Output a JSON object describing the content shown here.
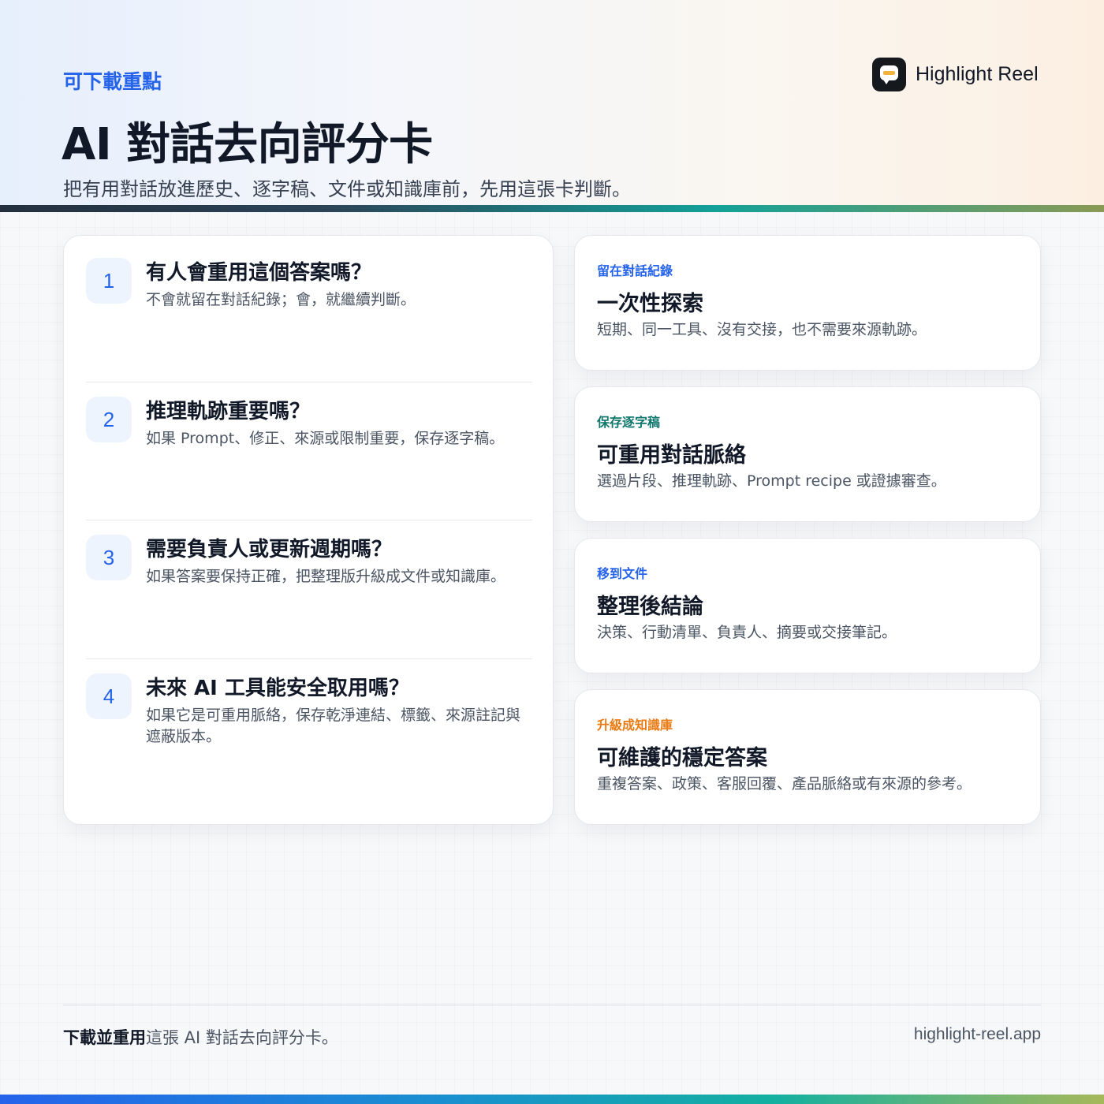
{
  "header": {
    "eyebrow": "可下載重點",
    "title": "AI 對話去向評分卡",
    "subtitle": "把有用對話放進歷史、逐字稿、文件或知識庫前，先用這張卡判斷。"
  },
  "brand": {
    "name": "Highlight Reel",
    "icon": "chat-bubble-icon"
  },
  "steps": [
    {
      "number": "1",
      "title": "有人會重用這個答案嗎？",
      "desc": "不會就留在對話紀錄；會，就繼續判斷。"
    },
    {
      "number": "2",
      "title": "推理軌跡重要嗎？",
      "desc": "如果 Prompt、修正、來源或限制重要，保存逐字稿。"
    },
    {
      "number": "3",
      "title": "需要負責人或更新週期嗎？",
      "desc": "如果答案要保持正確，把整理版升級成文件或知識庫。"
    },
    {
      "number": "4",
      "title": "未來 AI 工具能安全取用嗎？",
      "desc": "如果它是可重用脈絡，保存乾淨連結、標籤、來源註記與遮蔽版本。"
    }
  ],
  "destinations": [
    {
      "tag": "留在對話紀錄",
      "tag_color": "#2563eb",
      "title": "一次性探索",
      "desc": "短期、同一工具、沒有交接，也不需要來源軌跡。"
    },
    {
      "tag": "保存逐字稿",
      "tag_color": "#0f766e",
      "title": "可重用對話脈絡",
      "desc": "選過片段、推理軌跡、Prompt recipe 或證據審查。"
    },
    {
      "tag": "移到文件",
      "tag_color": "#2563eb",
      "title": "整理後結論",
      "desc": "決策、行動清單、負責人、摘要或交接筆記。"
    },
    {
      "tag": "升級成知識庫",
      "tag_color": "#ea7a12",
      "title": "可維護的穩定答案",
      "desc": "重複答案、政策、客服回覆、產品脈絡或有來源的參考。"
    }
  ],
  "footer": {
    "cta_bold": "下載並重用",
    "cta_rest": "這張 AI 對話去向評分卡。",
    "url": "highlight-reel.app"
  }
}
